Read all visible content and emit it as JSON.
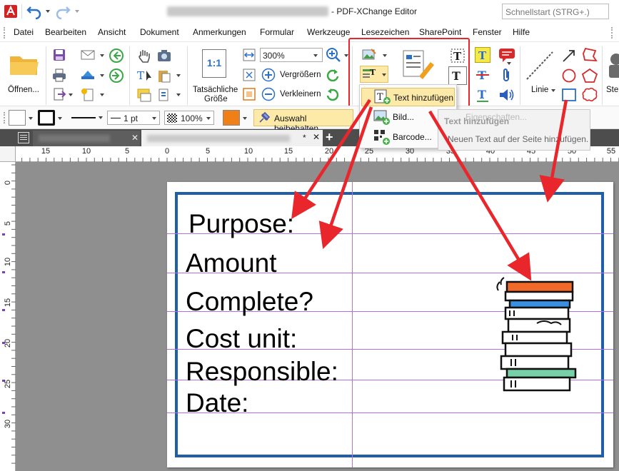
{
  "window": {
    "app_title": "- PDF-XChange Editor",
    "search_placeholder": "Schnellstart (STRG+.)"
  },
  "menu": {
    "items": [
      "Datei",
      "Bearbeiten",
      "Ansicht",
      "Dokument",
      "Anmerkungen",
      "Formular",
      "Werkzeuge",
      "Lesezeichen",
      "SharePoint",
      "Fenster",
      "Hilfe"
    ]
  },
  "ribbon": {
    "open_label": "Öffnen...",
    "actual_size_label": "Tatsächliche",
    "actual_size_label2": "Größe",
    "actual_size_icon_text": "1:1",
    "zoom_value": "300%",
    "zoom_in_label": "Vergrößern",
    "zoom_out_label": "Verkleinern",
    "line_label": "Linie",
    "cut_label": "Ste"
  },
  "propbar": {
    "line_width": "1 pt",
    "opacity": "100%",
    "keep_selection": "Auswahl beibehalten"
  },
  "tab": {
    "modified_marker": "*",
    "add_tab": "+"
  },
  "ruler": {
    "h_numbers": [
      "15",
      "10",
      "5",
      "0",
      "5",
      "10",
      "15",
      "20",
      "25",
      "30",
      "35",
      "40",
      "45",
      "50",
      "55"
    ],
    "v_numbers": [
      "0",
      "5",
      "10",
      "15",
      "20",
      "25",
      "30"
    ]
  },
  "page": {
    "lines": [
      "Purpose:",
      "Amount",
      "Complete?",
      "Cost unit:",
      "Responsible:",
      "Date:"
    ]
  },
  "dropdown": {
    "items": [
      "Text hinzufügen",
      "Bild...",
      "Barcode..."
    ]
  },
  "tooltip": {
    "title": "Text hinzufügen",
    "faded": "Eigenschaften...",
    "description": "Neuen Text auf der Seite hinzufügen."
  },
  "colors": {
    "accent_blue": "#1f5fa8",
    "highlight_red": "#e8262b",
    "guide_purple": "#b571e4",
    "keep_btn_bg": "#fde9a8"
  }
}
